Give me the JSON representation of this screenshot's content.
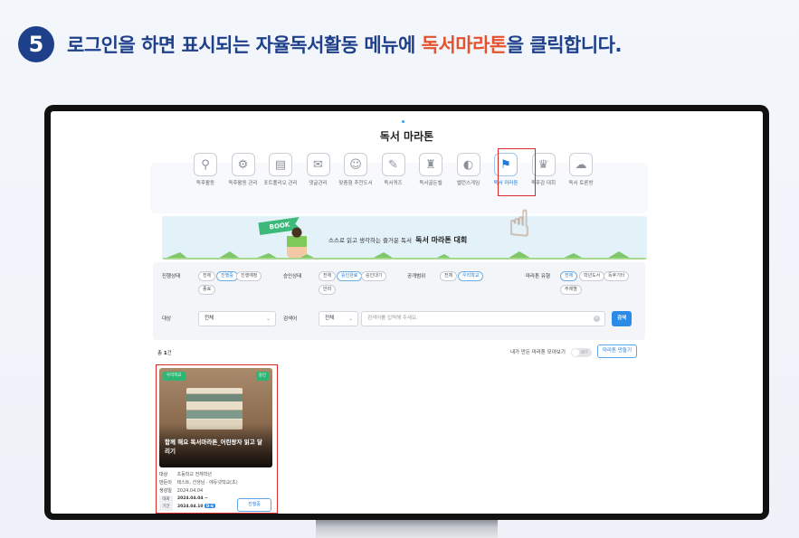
{
  "instruction": {
    "step": "5",
    "text_before": "로그인을 하면 표시되는 자율독서활동 메뉴에 ",
    "text_highlight": "독서마라톤",
    "text_after": "을 클릭합니다."
  },
  "page": {
    "title": "독서 마라톤"
  },
  "menu": {
    "items": [
      {
        "label": "독후활동",
        "icon": "stamp-icon",
        "glyph": "⚲"
      },
      {
        "label": "독후활동 관리",
        "icon": "stamp-settings-icon",
        "glyph": "⚙"
      },
      {
        "label": "포트폴리오 관리",
        "icon": "portfolio-icon",
        "glyph": "▤"
      },
      {
        "label": "댓글관리",
        "icon": "comment-icon",
        "glyph": "✉"
      },
      {
        "label": "맞춤형 추천도서",
        "icon": "recommend-book-icon",
        "glyph": "☺"
      },
      {
        "label": "독서퀴즈",
        "icon": "quiz-icon",
        "glyph": "✎"
      },
      {
        "label": "독서골든벨",
        "icon": "golden-bell-icon",
        "glyph": "♜"
      },
      {
        "label": "밸런스게임",
        "icon": "balance-game-icon",
        "glyph": "◐"
      },
      {
        "label": "독서 마라톤",
        "icon": "marathon-icon",
        "glyph": "⚑",
        "active": true
      },
      {
        "label": "독후감 대회",
        "icon": "trophy-icon",
        "glyph": "♛"
      },
      {
        "label": "독서 토론방",
        "icon": "discussion-icon",
        "glyph": "☁"
      }
    ]
  },
  "banner": {
    "flag": "BOOK",
    "text_small": "스스로 읽고 생각하는 즐거운 독서",
    "text_bold": "독서 마라톤 대회"
  },
  "filters": {
    "progress": {
      "label": "진행상태",
      "options": [
        "전체",
        "진행중",
        "진행예정",
        "종료"
      ],
      "selected": "진행중"
    },
    "approval": {
      "label": "승인상태",
      "options": [
        "전체",
        "승인완료",
        "승인대기",
        "반려"
      ],
      "selected": "승인완료"
    },
    "visibility": {
      "label": "공개범위",
      "options": [
        "전체",
        "우리학교"
      ],
      "selected": "우리학교"
    },
    "marathon_type": {
      "label": "마라톤 유형",
      "options": [
        "전체",
        "학년도서",
        "독후기타",
        "주제별"
      ],
      "selected": "전체"
    },
    "target": {
      "label": "대상",
      "value": "전체"
    },
    "keyword": {
      "label": "검색어",
      "scope": "전체",
      "placeholder": "검색어를 입력해 주세요."
    },
    "search_button": "검색"
  },
  "results": {
    "total_label": "총",
    "total_count": "1",
    "total_unit": "건",
    "mine_label": "내가 만든 마라톤 모아보기",
    "toggle_text": "OFF",
    "create_button": "마라톤 만들기"
  },
  "card": {
    "badge_scope": "우리학교",
    "badge_status": "승인",
    "title": "함께 해요 독서마라톤_어린왕자 읽고 달리기",
    "target_label": "대상",
    "target_value": "초등학교 전체학년",
    "author_label": "만든이",
    "author_value": "테스트, 선생님 · 에듀넷학교(초)",
    "created_label": "생성일",
    "created_value": "2024.04.04",
    "period_label_1": "대회",
    "period_label_2": "기간",
    "period_start": "2024.04.04 ~",
    "period_end": "2024.04.10",
    "dday": "D-6",
    "status_button": "진행중"
  }
}
